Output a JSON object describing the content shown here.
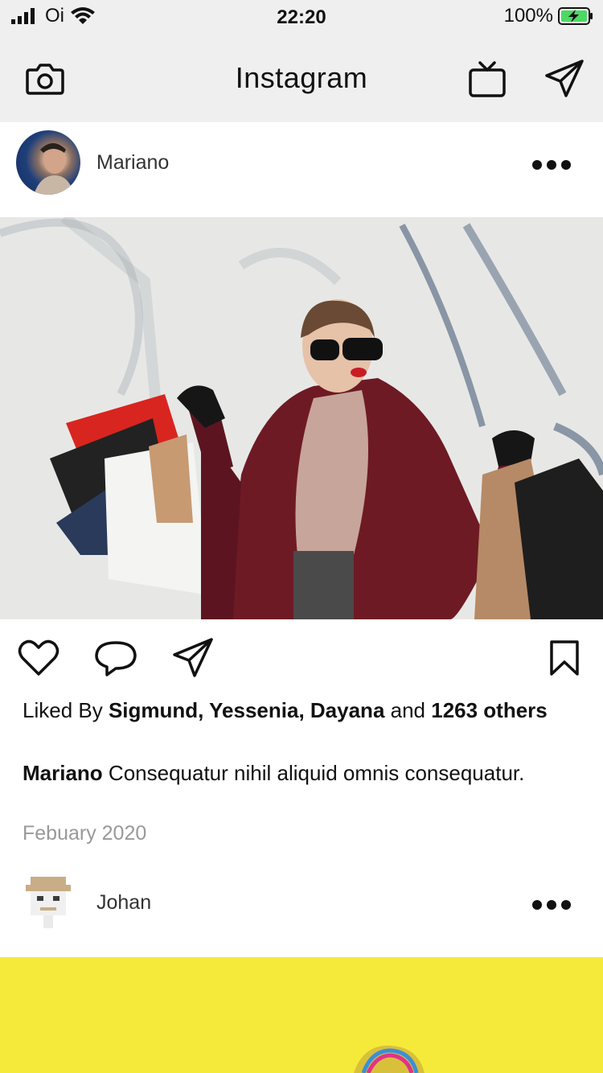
{
  "status_bar": {
    "carrier": "Oi",
    "time": "22:20",
    "battery_percent": "100%",
    "battery_level": 1.0
  },
  "nav": {
    "title": "Instagram",
    "icons": [
      "camera-icon",
      "tv-icon",
      "direct-message-icon"
    ]
  },
  "posts": [
    {
      "username": "Mariano",
      "avatar": "avatar-mariano",
      "liked_by_prefix": "Liked By ",
      "liked_by_names": "Sigmund, Yessenia, Dayana",
      "liked_by_and": " and ",
      "liked_by_count": "1263 others",
      "caption_user": "Mariano",
      "caption_text": " Consequatur nihil aliquid omnis consequatur.",
      "date": "Febuary 2020"
    },
    {
      "username": "Johan",
      "avatar": "avatar-johan"
    }
  ],
  "actions": [
    "heart-icon",
    "comment-icon",
    "share-icon",
    "bookmark-icon"
  ],
  "colors": {
    "bar_background": "#efefef",
    "battery_green": "#4cd964",
    "date_gray": "#999999",
    "yellow_post": "#f5ea3a"
  }
}
